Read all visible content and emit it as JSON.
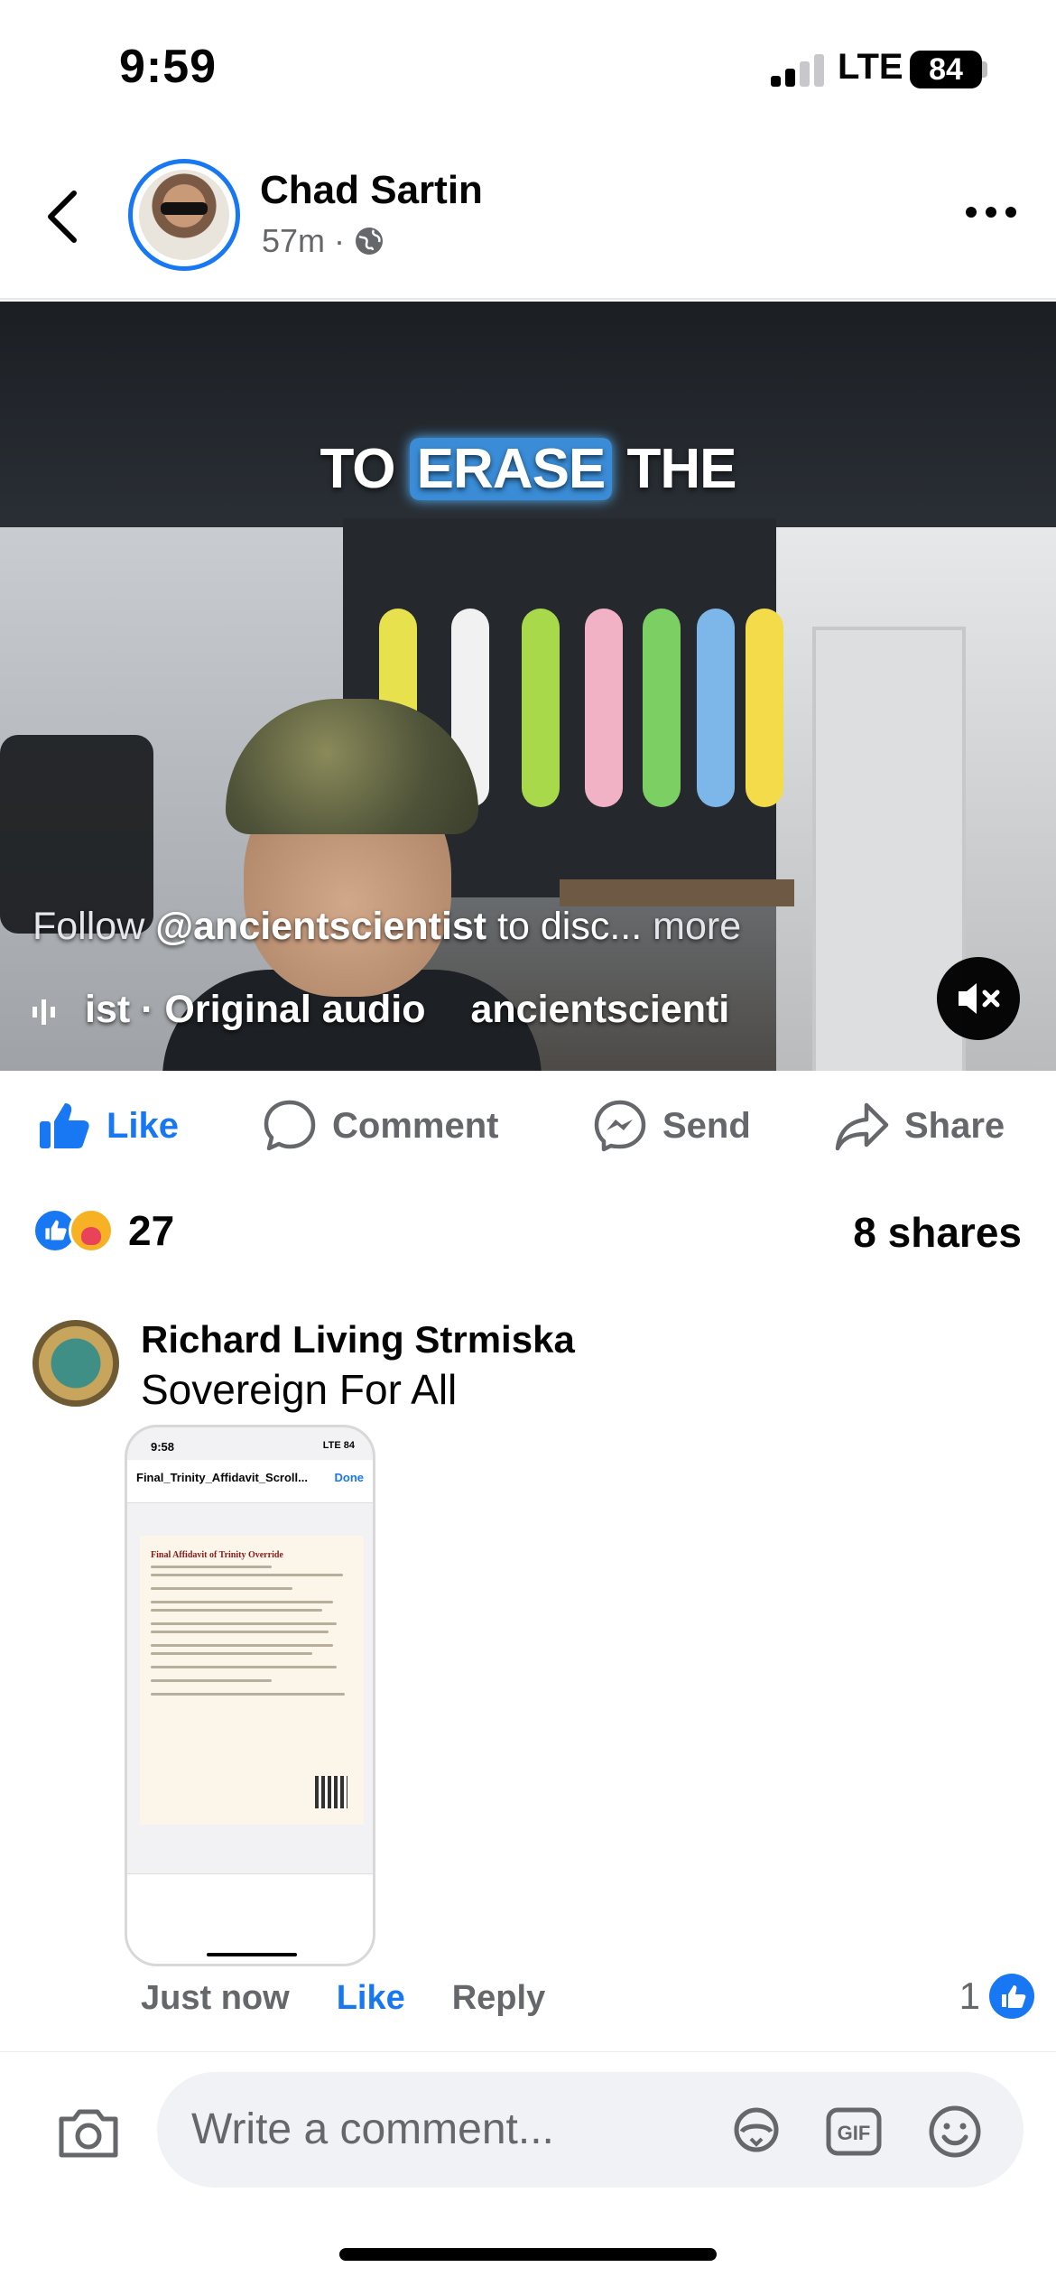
{
  "status_bar": {
    "time": "9:59",
    "network": "LTE",
    "battery": "84"
  },
  "post": {
    "author": "Chad Sartin",
    "age": "57m",
    "separator": "·"
  },
  "video": {
    "caption_before": "TO ",
    "caption_highlight": "ERASE",
    "caption_after": " THE",
    "follow_prefix": "Follow ",
    "follow_handle": "@ancientscientist",
    "follow_suffix": " to disc...",
    "follow_more": " more",
    "audio_text": "ist · Original audio",
    "audio_account": "ancientscienti"
  },
  "actions": {
    "like": "Like",
    "comment": "Comment",
    "send": "Send",
    "share": "Share"
  },
  "engagement": {
    "reaction_count": "27",
    "shares": "8 shares"
  },
  "comment": {
    "author": "Richard Living Strmiska",
    "text": "Sovereign For All",
    "attachment": {
      "time": "9:58",
      "network": "LTE 84",
      "file_name": "Final_Trinity_Affidavit_Scroll...",
      "done_label": "Done",
      "doc_title": "Final Affidavit of Trinity Override"
    },
    "timestamp": "Just now",
    "like_label": "Like",
    "reply_label": "Reply",
    "like_count": "1"
  },
  "composer": {
    "placeholder": "Write a comment..."
  },
  "colors": {
    "accent": "#1877f2",
    "muted": "#65676b",
    "field": "#f0f2f5"
  }
}
